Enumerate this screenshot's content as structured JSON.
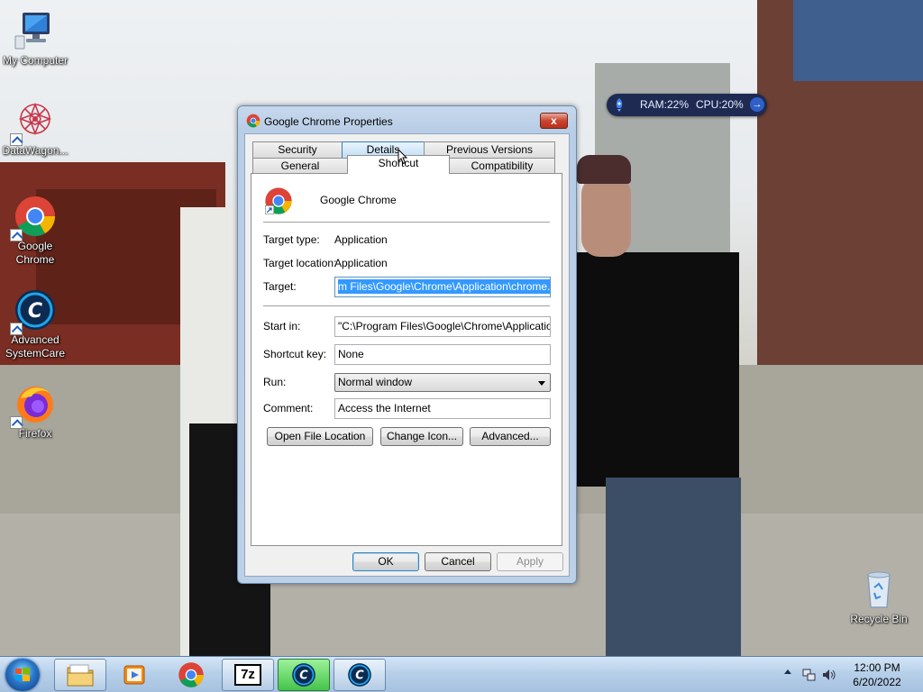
{
  "desktop": {
    "icons": [
      {
        "label": "My Computer",
        "icon": "computer-icon"
      },
      {
        "label": "DataWagon...",
        "icon": "datawagon-icon"
      },
      {
        "label": "Google Chrome",
        "icon": "chrome-icon"
      },
      {
        "label": "Advanced SystemCare",
        "icon": "systemcare-icon"
      },
      {
        "label": "Firefox",
        "icon": "firefox-icon"
      },
      {
        "label": "Recycle Bin",
        "icon": "recycle-bin-icon"
      }
    ]
  },
  "widget": {
    "ram": "RAM:22%",
    "cpu": "CPU:20%"
  },
  "dialog": {
    "title": "Google Chrome Properties",
    "close": "x",
    "tabs_row1": [
      "Security",
      "Details",
      "Previous Versions"
    ],
    "tabs_row2": [
      "General",
      "Shortcut",
      "Compatibility"
    ],
    "active_tab": "Shortcut",
    "app_name": "Google Chrome",
    "target_type_label": "Target type:",
    "target_type": "Application",
    "target_location_label": "Target location:",
    "target_location": "Application",
    "target_label": "Target:",
    "target_value": "m Files\\Google\\Chrome\\Application\\chrome.exe\"",
    "start_in_label": "Start in:",
    "start_in": "\"C:\\Program Files\\Google\\Chrome\\Application\"",
    "shortcut_key_label": "Shortcut key:",
    "shortcut_key": "None",
    "run_label": "Run:",
    "run": "Normal window",
    "comment_label": "Comment:",
    "comment": "Access the Internet",
    "buttons": {
      "open_file_location": "Open File Location",
      "change_icon": "Change Icon...",
      "advanced": "Advanced...",
      "ok": "OK",
      "cancel": "Cancel",
      "apply": "Apply"
    }
  },
  "taskbar": {
    "items": [
      "windows-explorer-icon",
      "media-player-icon",
      "chrome-icon",
      "7zip-icon",
      "systemcare-icon",
      "systemcare-icon"
    ],
    "zip_label": "7z",
    "time": "12:00 PM",
    "date": "6/20/2022"
  }
}
